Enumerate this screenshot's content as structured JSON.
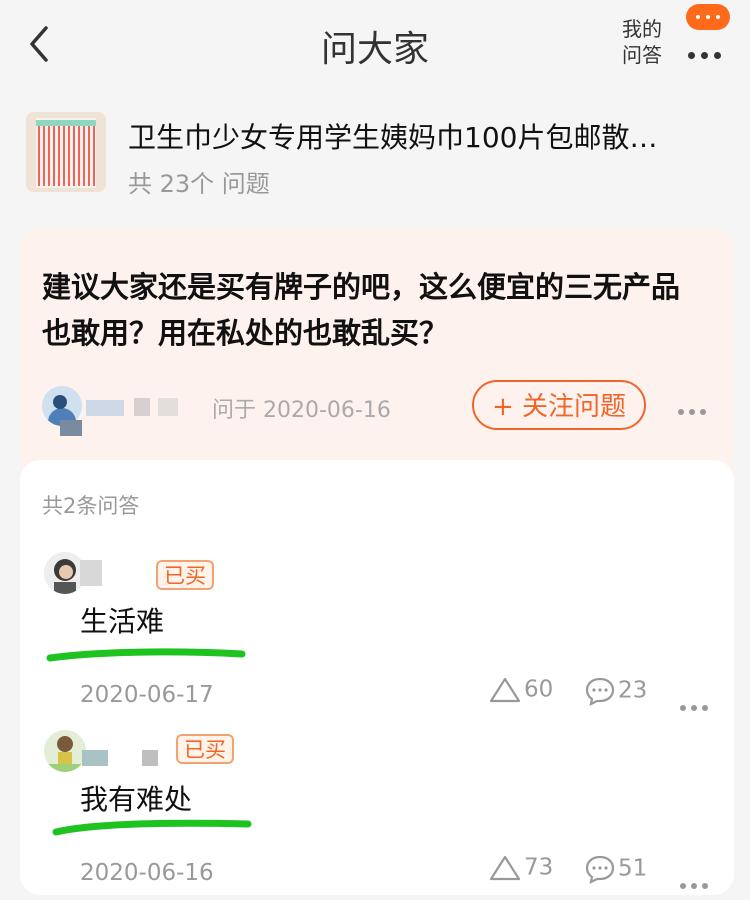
{
  "header": {
    "title": "问大家",
    "my_qa_line1": "我的",
    "my_qa_line2": "问答"
  },
  "product": {
    "title": "卫生巾少女专用学生姨妈巾100片包邮散…",
    "count": "共 23个 问题"
  },
  "question": {
    "text": "建议大家还是买有牌子的吧，这么便宜的三无产品也敢用？用在私处的也敢乱买？",
    "asked_on": "问于 2020-06-16",
    "follow_label": "+ 关注问题"
  },
  "answers_section": {
    "count_label": "共2条问答",
    "items": [
      {
        "badge": "已买",
        "text": "生活难",
        "date": "2020-06-17",
        "likes": "60",
        "comments": "23"
      },
      {
        "badge": "已买",
        "text": "我有难处",
        "date": "2020-06-16",
        "likes": "73",
        "comments": "51"
      }
    ]
  },
  "colors": {
    "accent": "#f2652a",
    "highlight_marker": "#1fc31f"
  }
}
